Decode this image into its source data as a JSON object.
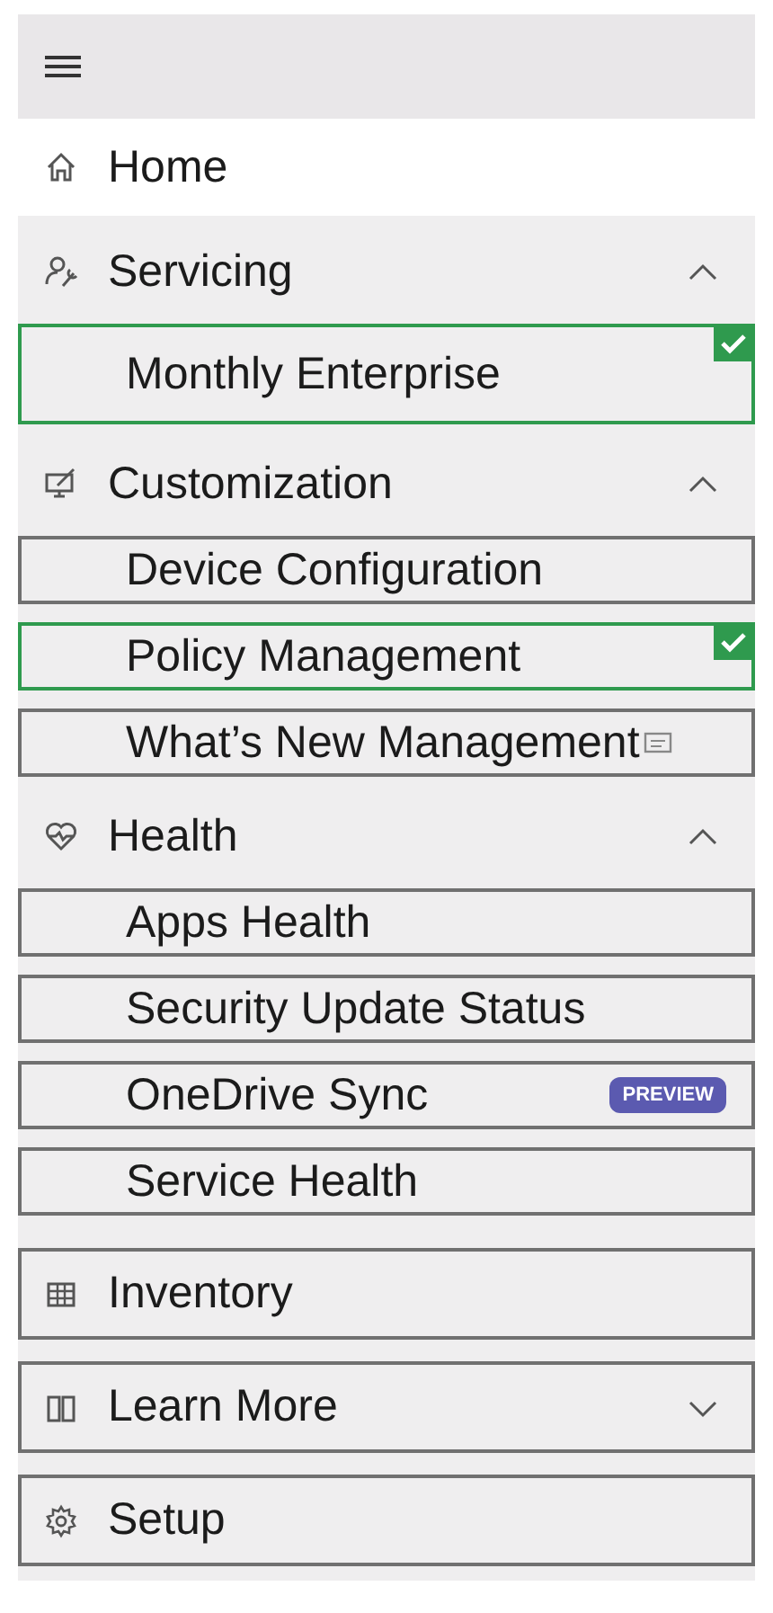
{
  "nav": [
    {
      "kind": "link",
      "label": "Home",
      "outlined": false
    },
    {
      "kind": "group",
      "label": "Servicing",
      "expanded": true,
      "outlined": false,
      "children": [
        {
          "label": "Monthly Enterprise",
          "checked": true
        }
      ]
    },
    {
      "kind": "group",
      "label": "Customization",
      "expanded": true,
      "outlined": false,
      "children": [
        {
          "label": "Device Configuration",
          "checked": false
        },
        {
          "label": "Policy Management",
          "checked": true
        },
        {
          "label": "What’s New Management",
          "checked": false,
          "external": true
        }
      ]
    },
    {
      "kind": "group",
      "label": "Health",
      "expanded": true,
      "outlined": false,
      "children": [
        {
          "label": "Apps Health",
          "checked": false
        },
        {
          "label": "Security Update Status",
          "checked": false
        },
        {
          "label": "OneDrive Sync",
          "checked": false,
          "badge": "PREVIEW"
        },
        {
          "label": "Service Health",
          "checked": false
        }
      ]
    },
    {
      "kind": "link",
      "label": "Inventory",
      "outlined": true
    },
    {
      "kind": "group",
      "label": "Learn More",
      "expanded": false,
      "outlined": true
    },
    {
      "kind": "link",
      "label": "Setup",
      "outlined": true
    }
  ]
}
